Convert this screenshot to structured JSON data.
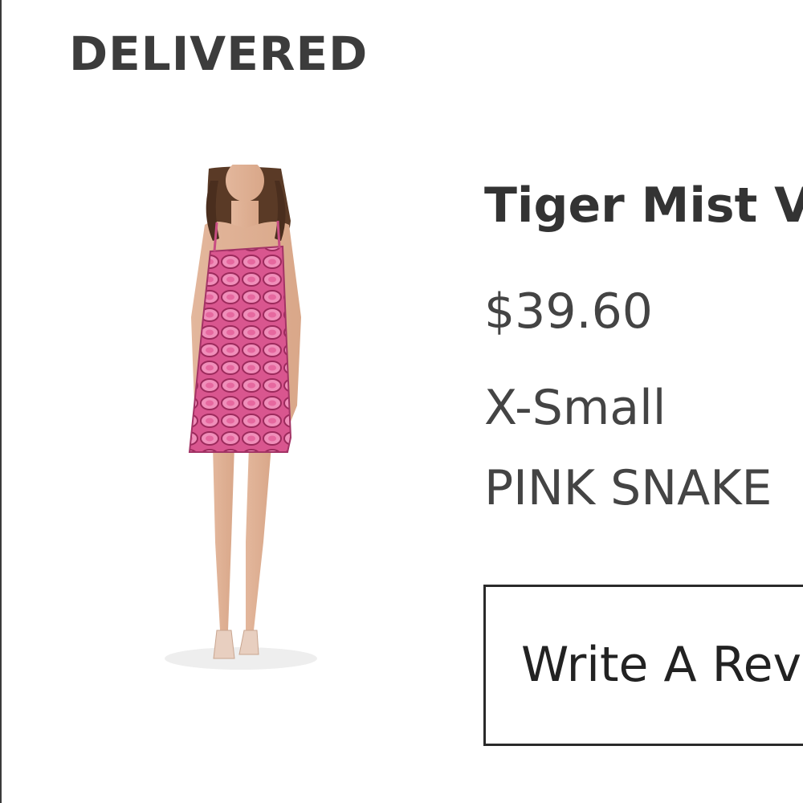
{
  "order": {
    "status": "DELIVERED"
  },
  "item": {
    "name": "Tiger Mist Viper",
    "price": "$39.60",
    "size": "X-Small",
    "color": "PINK SNAKE",
    "image_alt": "product-photo-pink-snake-print-dress"
  },
  "actions": {
    "review_label": "Write A Review"
  },
  "colors": {
    "border": "#2a2a2a",
    "text": "#333333",
    "dress_pink": "#d8528f"
  }
}
